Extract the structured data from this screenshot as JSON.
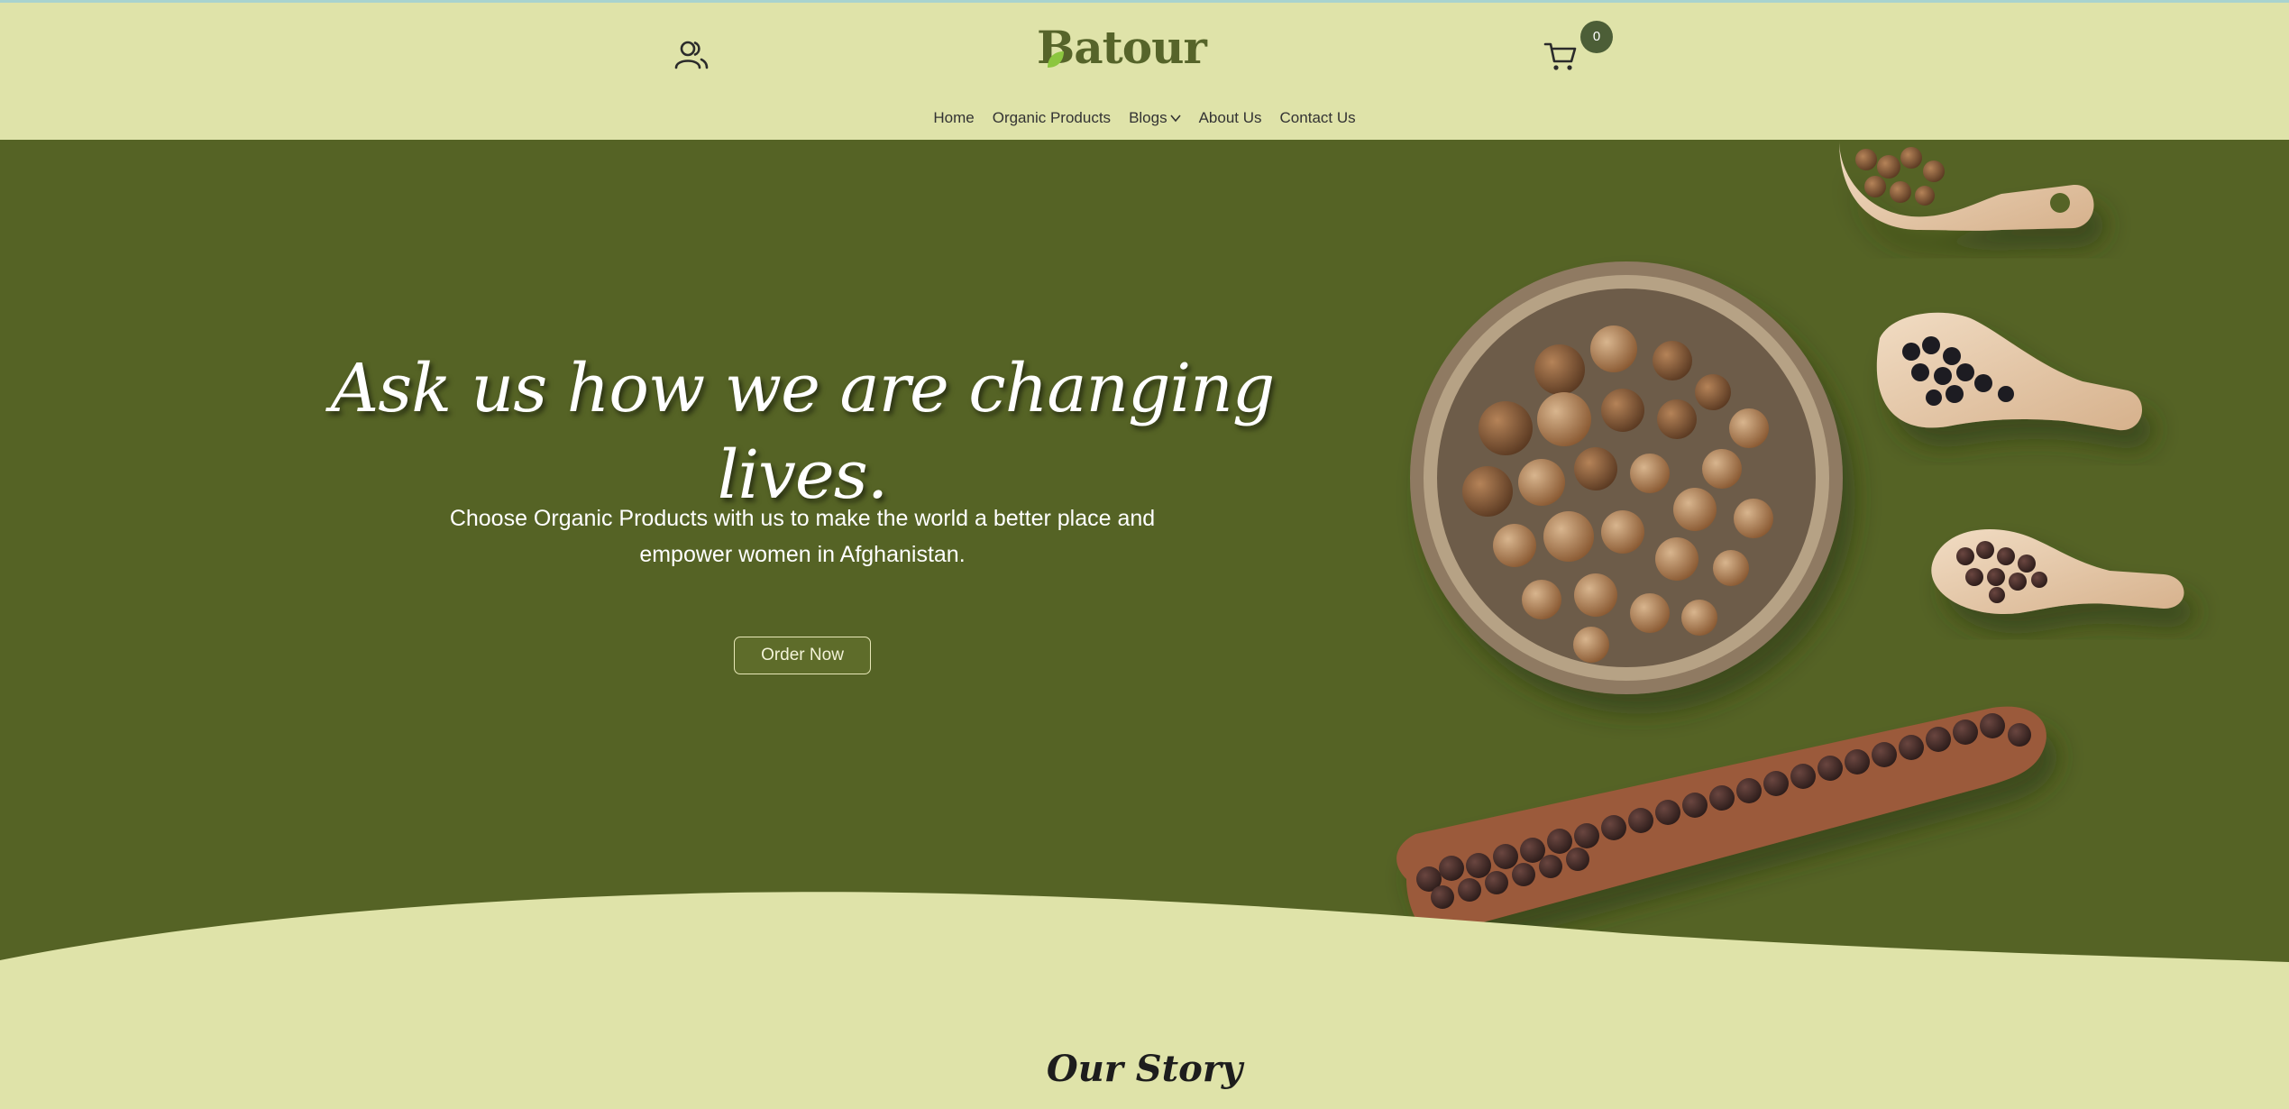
{
  "header": {
    "brand": "Batour",
    "cart_count": "0"
  },
  "nav": {
    "items": [
      {
        "label": "Home"
      },
      {
        "label": "Organic Products"
      },
      {
        "label": "Blogs"
      },
      {
        "label": "About Us"
      },
      {
        "label": "Contact Us"
      }
    ]
  },
  "hero": {
    "headline": "Ask us how we are changing lives.",
    "subtext": "Choose Organic Products with us to make the world a better place and empower women in Afghanistan.",
    "cta_label": "Order Now"
  },
  "story": {
    "title": "Our Story"
  },
  "colors": {
    "page_background": "#dfe3a9",
    "hero_background": "#556325",
    "brand_green": "#56642a",
    "badge": "#4c5e37"
  },
  "icons": [
    "user-icon",
    "shopping-cart-icon",
    "chevron-down-icon",
    "leaf-icon"
  ]
}
